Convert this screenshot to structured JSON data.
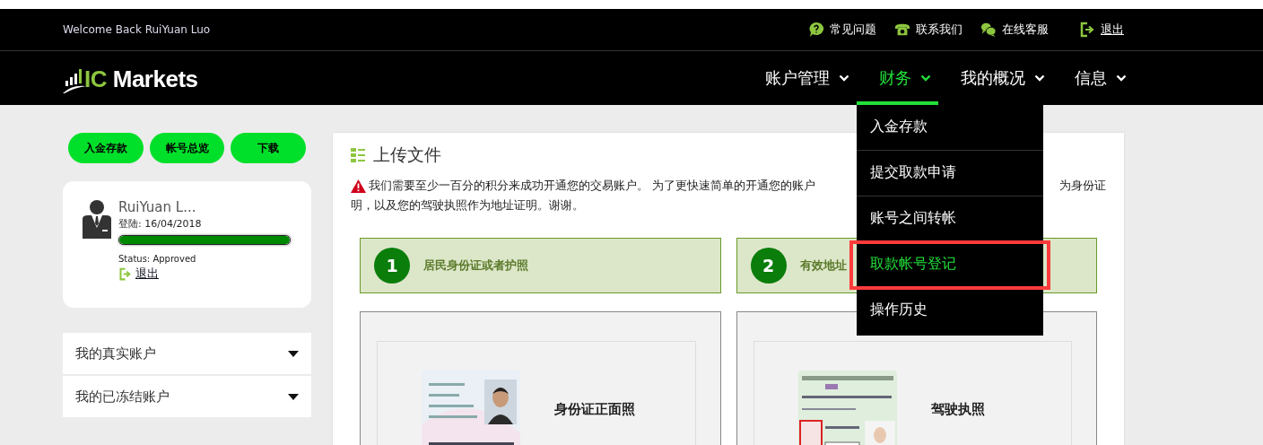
{
  "header": {
    "welcome": "Welcome Back RuiYuan Luo",
    "links": [
      {
        "label": "常见问题",
        "kind": "faq"
      },
      {
        "label": "联系我们",
        "kind": "contact"
      },
      {
        "label": "在线客服",
        "kind": "chat"
      },
      {
        "label": "退出",
        "kind": "logout"
      }
    ]
  },
  "logo": {
    "highlight": "IC",
    "text": "Markets"
  },
  "nav": [
    {
      "label": "账户管理",
      "selected": false
    },
    {
      "label": "财务",
      "selected": true
    },
    {
      "label": "我的概况",
      "selected": false
    },
    {
      "label": "信息",
      "selected": false
    }
  ],
  "finance_menu": [
    {
      "label": "入金存款",
      "selected": false
    },
    {
      "label": "提交取款申请",
      "selected": false
    },
    {
      "label": "账号之间转帐",
      "selected": false
    },
    {
      "label": "取款帐号登记",
      "selected": true
    },
    {
      "label": "操作历史",
      "selected": false
    }
  ],
  "quick_buttons": [
    "入金存款",
    "帐号总览",
    "下载"
  ],
  "profile": {
    "name": "RuiYuan L...",
    "login": "登陆: 16/04/2018",
    "level": 1,
    "status": "Status: Approved",
    "logout": "退出"
  },
  "accounts": [
    {
      "label": "我的真实账户",
      "expanded": false
    },
    {
      "label": "我的已冻结账户",
      "expanded": false
    }
  ],
  "upload": {
    "title": "上传文件",
    "notice": [
      "我们需要至少一百分的积分来成功开通您的交易账户。 为了更快速简单的开通您的账户",
      "为身份证",
      "明，以及您的驾驶执照作为地址证明。谢谢。"
    ],
    "steps": [
      {
        "number": "1",
        "label": "居民身份证或者护照"
      },
      {
        "number": "2",
        "label": "有效地址"
      }
    ],
    "documents": [
      {
        "kind": "id_card",
        "caption": "身份证正面照"
      },
      {
        "kind": "license",
        "caption": "驾驶执照"
      }
    ]
  }
}
